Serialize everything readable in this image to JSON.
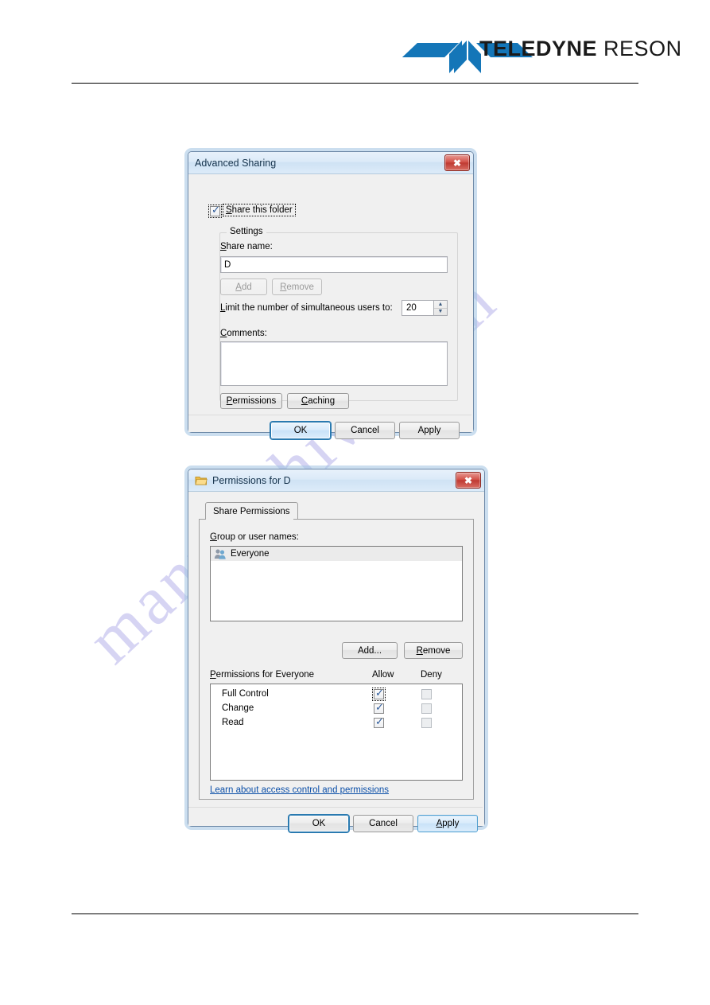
{
  "page": {
    "brand_bold": "TELEDYNE",
    "brand_light": "RESON",
    "logo_icon": "teledyne-chevron-logo",
    "watermark_text": "manualshive.com"
  },
  "advanced_sharing": {
    "title": "Advanced Sharing",
    "close_icon": "close-icon",
    "share_this_folder": {
      "label": "Share this folder",
      "checked": true,
      "accel": "S"
    },
    "settings_group": {
      "title": "Settings",
      "share_name_label": "Share name:",
      "share_name_value": "D",
      "add_button": "Add",
      "remove_button": "Remove",
      "limit_label": "Limit the number of simultaneous users to:",
      "limit_value": "20",
      "spin_up_icon": "spinner-up-icon",
      "spin_down_icon": "spinner-down-icon",
      "comments_label": "Comments:",
      "comments_value": "",
      "permissions_button": "Permissions",
      "caching_button": "Caching"
    },
    "footer": {
      "ok": "OK",
      "cancel": "Cancel",
      "apply": "Apply"
    }
  },
  "permissions_dialog": {
    "title": "Permissions for D",
    "title_icon": "folder-icon",
    "close_icon": "close-icon",
    "tabs": [
      {
        "label": "Share Permissions",
        "active": true
      }
    ],
    "group_or_user_names_label": "Group or user names:",
    "users": [
      {
        "name": "Everyone",
        "icon": "users-group-icon",
        "selected": true
      }
    ],
    "add_button": "Add...",
    "remove_button": "Remove",
    "permissions_for_label": "Permissions for Everyone",
    "columns": [
      "Allow",
      "Deny"
    ],
    "rows": [
      {
        "name": "Full Control",
        "allow": true,
        "deny": false,
        "allow_focused": true
      },
      {
        "name": "Change",
        "allow": true,
        "deny": false,
        "allow_focused": false
      },
      {
        "name": "Read",
        "allow": true,
        "deny": false,
        "allow_focused": false
      }
    ],
    "learn_link": "Learn about access control and permissions",
    "footer": {
      "ok": "OK",
      "cancel": "Cancel",
      "apply": "Apply"
    }
  },
  "colors": {
    "brand_blue": "#1476b8",
    "title_text": "#16334c",
    "link": "#0b4fa8",
    "close_red": "#bf3a32",
    "watermark": "#cfcdf2"
  }
}
